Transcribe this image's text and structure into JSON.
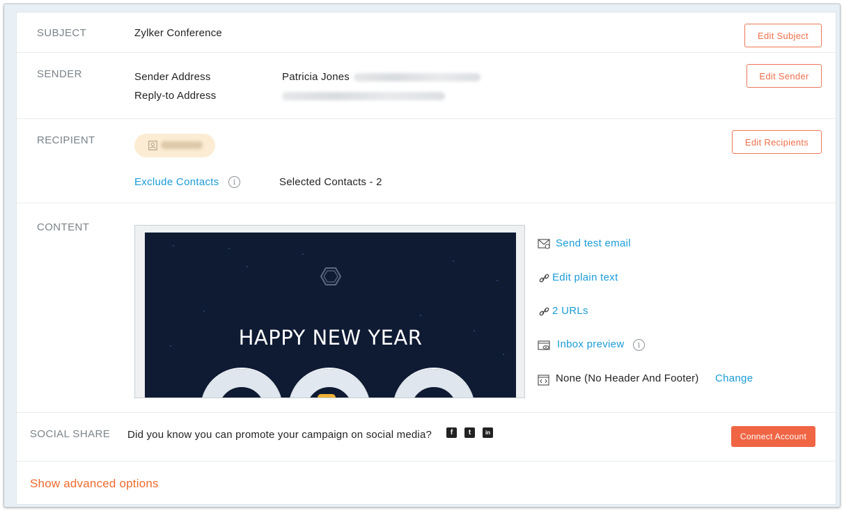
{
  "subject": {
    "label": "SUBJECT",
    "value": "Zylker Conference",
    "edit_button": "Edit Subject"
  },
  "sender": {
    "label": "SENDER",
    "address_label": "Sender Address",
    "reply_to_label": "Reply-to Address",
    "sender_name": "Patricia Jones",
    "edit_button": "Edit Sender"
  },
  "recipient": {
    "label": "RECIPIENT",
    "exclude_link": "Exclude Contacts",
    "info_glyph": "i",
    "selected_text": "Selected Contacts - 2",
    "edit_button": "Edit Recipients"
  },
  "content": {
    "label": "CONTENT",
    "preview_heading": "HAPPY NEW YEAR",
    "actions": {
      "send_test": "Send test email",
      "edit_plain": "Edit plain text",
      "urls": "2 URLs",
      "inbox_preview": "Inbox preview",
      "header_footer": "None (No Header And Footer)",
      "change": "Change"
    }
  },
  "social": {
    "label": "SOCIAL SHARE",
    "prompt": "Did you know you can promote your campaign on social media?",
    "icons": [
      "facebook-icon",
      "twitter-icon",
      "linkedin-icon"
    ],
    "facebook_glyph": "f",
    "twitter_glyph": "t",
    "linkedin_glyph": "in",
    "connect_button": "Connect Account"
  },
  "advanced": {
    "link": "Show advanced options"
  },
  "colors": {
    "accent": "#ef6f4b",
    "link": "#1a9bd7",
    "solid_button": "#f06544",
    "chip": "#fbecd3",
    "preview_bg": "#0f1a33"
  }
}
